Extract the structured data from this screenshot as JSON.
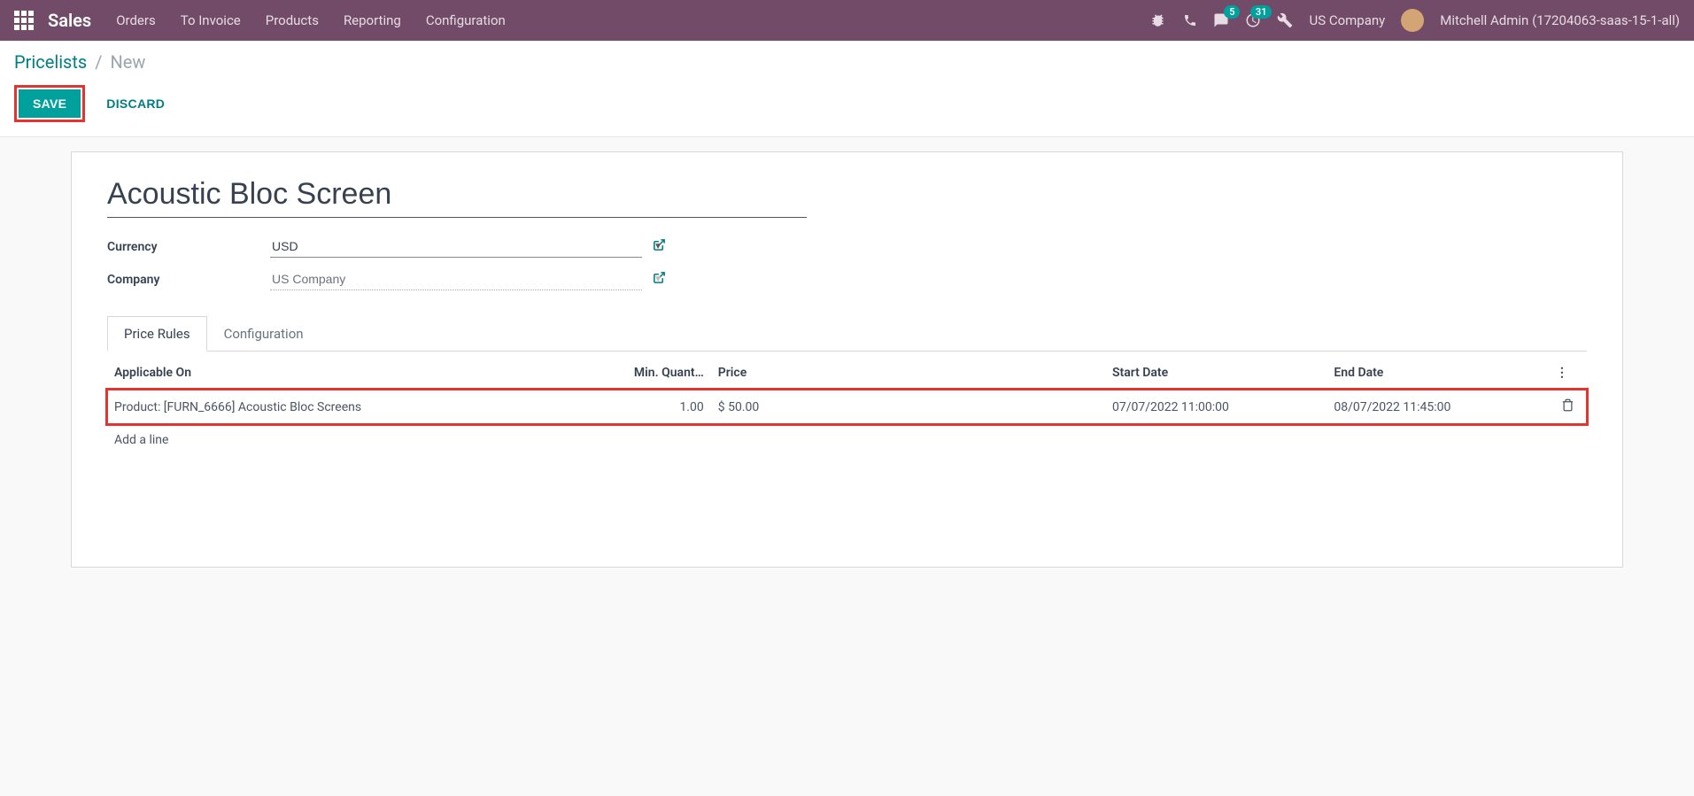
{
  "topbar": {
    "brand": "Sales",
    "menu": [
      "Orders",
      "To Invoice",
      "Products",
      "Reporting",
      "Configuration"
    ],
    "messages_badge": "5",
    "activities_badge": "31",
    "company": "US Company",
    "user": "Mitchell Admin (17204063-saas-15-1-all)"
  },
  "breadcrumb": {
    "parent": "Pricelists",
    "current": "New"
  },
  "actions": {
    "save": "SAVE",
    "discard": "DISCARD"
  },
  "form": {
    "title": "Acoustic Bloc Screen",
    "currency_label": "Currency",
    "currency_value": "USD",
    "company_label": "Company",
    "company_value": "US Company"
  },
  "tabs": {
    "price_rules": "Price Rules",
    "configuration": "Configuration"
  },
  "table": {
    "headers": {
      "applicable_on": "Applicable On",
      "min_qty": "Min. Quant…",
      "price": "Price",
      "start_date": "Start Date",
      "end_date": "End Date"
    },
    "rows": [
      {
        "applicable_on": "Product: [FURN_6666] Acoustic Bloc Screens",
        "min_qty": "1.00",
        "price": "$ 50.00",
        "start_date": "07/07/2022 11:00:00",
        "end_date": "08/07/2022 11:45:00"
      }
    ],
    "add_line": "Add a line"
  }
}
